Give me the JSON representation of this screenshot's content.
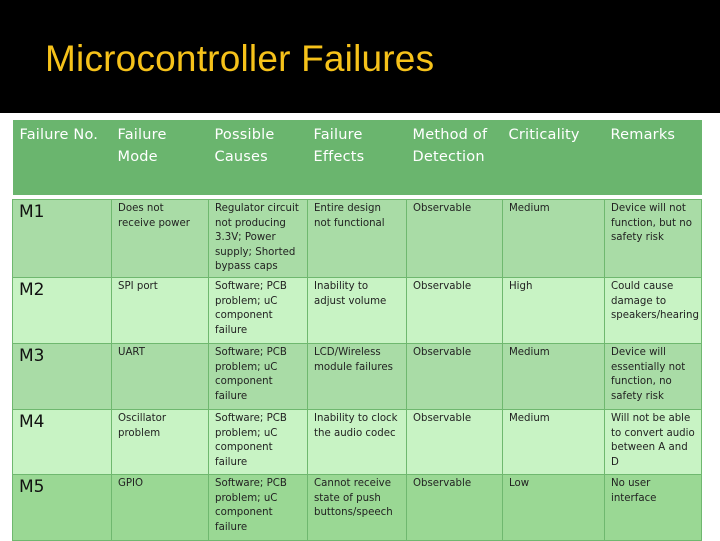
{
  "slide": {
    "title": "Microcontroller Failures",
    "colors": {
      "title_bar_bg": "#000000",
      "title_text": "#f6c21a",
      "header_bg": "#6ab56e",
      "row_dark_bg": "#a9dca6",
      "row_light_bg": "#c8f3c4"
    }
  },
  "table": {
    "headers": [
      "Failure No.",
      "Failure Mode",
      "Possible Causes",
      "Failure Effects",
      "Method of Detection",
      "Criticality",
      "Remarks"
    ],
    "rows": [
      {
        "id": "M1",
        "mode": "Does not receive power",
        "causes": "Regulator circuit not producing 3.3V; Power supply; Shorted bypass caps",
        "effects": "Entire design not functional",
        "detection": "Observable",
        "criticality": "Medium",
        "remarks": "Device will not function, but no safety risk"
      },
      {
        "id": "M2",
        "mode": "SPI port",
        "causes": "Software; PCB problem; uC component failure",
        "effects": "Inability to adjust volume",
        "detection": "Observable",
        "criticality": "High",
        "remarks": "Could cause damage to speakers/hearing"
      },
      {
        "id": "M3",
        "mode": "UART",
        "causes": "Software; PCB problem; uC component failure",
        "effects": "LCD/Wireless module failures",
        "detection": "Observable",
        "criticality": "Medium",
        "remarks": "Device will essentially not function, no safety risk"
      },
      {
        "id": "M4",
        "mode": "Oscillator problem",
        "causes": "Software; PCB problem; uC component failure",
        "effects": "Inability to clock the audio codec",
        "detection": "Observable",
        "criticality": "Medium",
        "remarks": "Will not be able to convert audio between A and D"
      },
      {
        "id": "M5",
        "mode": "GPIO",
        "causes": "Software; PCB problem; uC component failure",
        "effects": "Cannot receive state of push buttons/speech",
        "detection": "Observable",
        "criticality": "Low",
        "remarks": "No user interface"
      }
    ]
  }
}
